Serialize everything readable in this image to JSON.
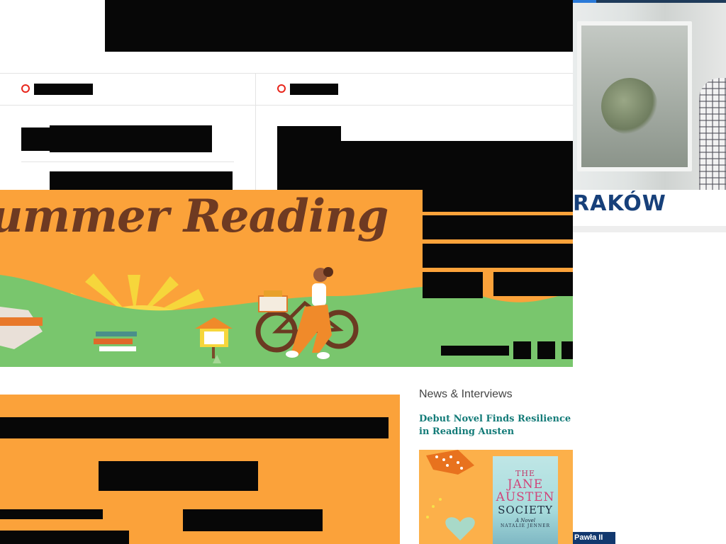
{
  "sidebar_photo": {
    "brand": "RAKÓW",
    "city_tag": "Pawła II"
  },
  "banner": {
    "title": "ummer Reading"
  },
  "news_section": {
    "heading": "News & Interviews",
    "article_title": "Debut Novel Finds Resilience in Reading Austen"
  },
  "book_cover": {
    "line1": "THE",
    "line2": "JANE",
    "line3": "AUSTEN",
    "line4": "SOCIETY",
    "line5": "A Novel",
    "line6": "NATALIE JENNER"
  },
  "colors": {
    "accent_orange": "#fba23a",
    "banner_title": "#6e3a22",
    "link_teal": "#137b78",
    "brand_navy": "#17407a",
    "indicator_red": "#e8251b"
  }
}
